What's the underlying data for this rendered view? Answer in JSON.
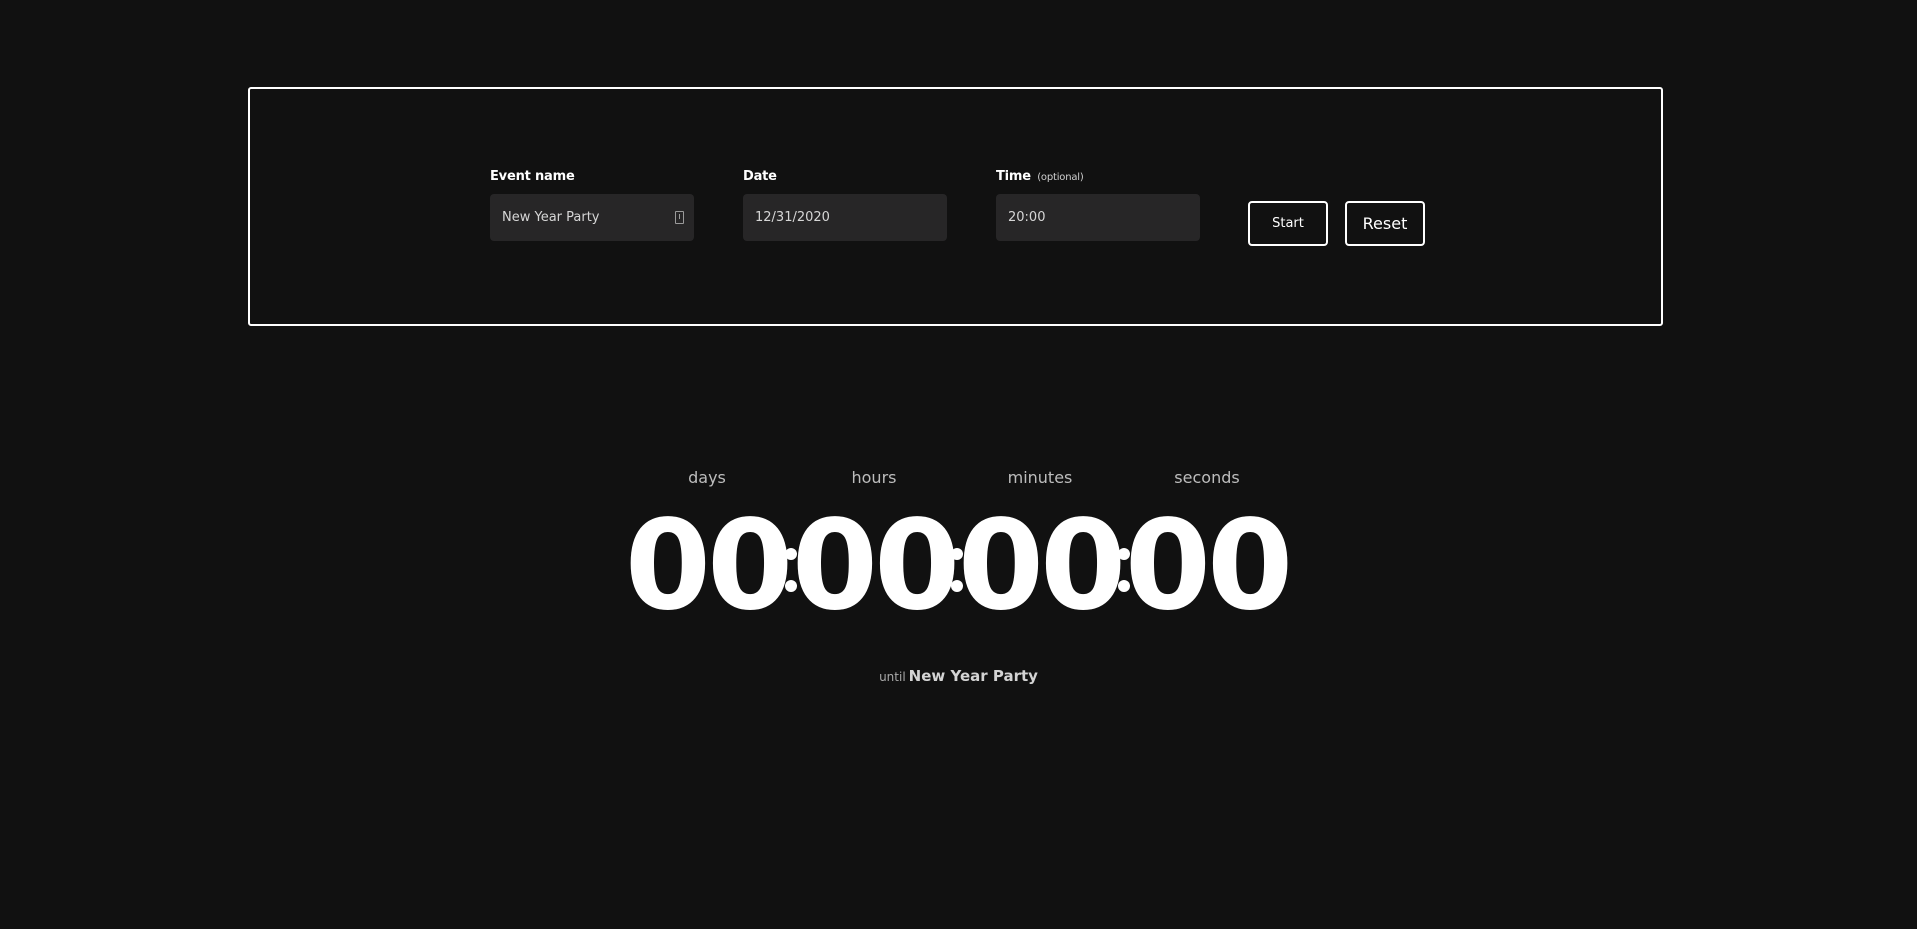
{
  "form": {
    "event_name": {
      "label": "Event name",
      "value": "New Year Party"
    },
    "date": {
      "label": "Date",
      "value": "12/31/2020"
    },
    "time": {
      "label": "Time",
      "optional": "(optional)",
      "value": "20:00"
    },
    "start_label": "Start",
    "reset_label": "Reset"
  },
  "countdown": {
    "labels": {
      "days": "days",
      "hours": "hours",
      "minutes": "minutes",
      "seconds": "seconds"
    },
    "values": {
      "days": "00",
      "hours": "00",
      "minutes": "00",
      "seconds": "00"
    }
  },
  "footer": {
    "until_word": "until",
    "event_name": "New Year Party"
  }
}
